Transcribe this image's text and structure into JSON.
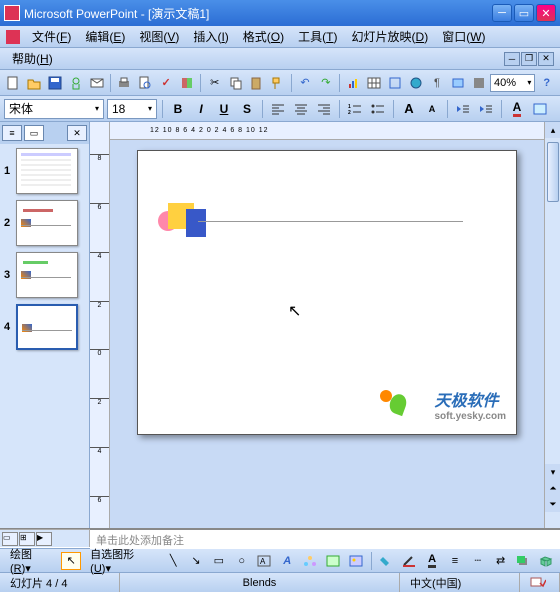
{
  "title": "Microsoft PowerPoint - [演示文稿1]",
  "menus": {
    "file": "文件",
    "file_u": "F",
    "edit": "编辑",
    "edit_u": "E",
    "view": "视图",
    "view_u": "V",
    "insert": "插入",
    "insert_u": "I",
    "format": "格式",
    "format_u": "O",
    "tools": "工具",
    "tools_u": "T",
    "slideshow": "幻灯片放映",
    "slideshow_u": "D",
    "window": "窗口",
    "window_u": "W",
    "help": "帮助",
    "help_u": "H"
  },
  "toolbar": {
    "zoom": "40%"
  },
  "format": {
    "font": "宋体",
    "size": "18",
    "bold": "B",
    "italic": "I",
    "underline": "U",
    "shadow": "S",
    "font_color": "A"
  },
  "ruler_h": "12 10 8 6 4 2 0 2 4 6 8 10 12",
  "thumbs": [
    {
      "num": "1"
    },
    {
      "num": "2"
    },
    {
      "num": "3"
    },
    {
      "num": "4"
    }
  ],
  "notes_placeholder": "单击此处添加备注",
  "draw": {
    "label": "绘图",
    "label_u": "R",
    "autoshapes": "自选图形",
    "autoshapes_u": "U"
  },
  "status": {
    "slide": "幻灯片 4 / 4",
    "design": "Blends",
    "lang": "中文(中国)"
  },
  "watermark": {
    "main": "天极软件",
    "sub": "soft.yesky.com"
  }
}
